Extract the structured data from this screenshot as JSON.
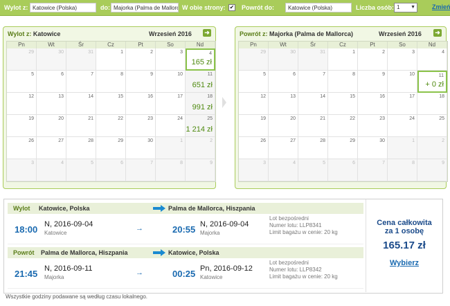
{
  "search": {
    "from_label": "Wylot z:",
    "from_value": "Katowice (Polska)",
    "to_label": "do:",
    "to_value": "Majorka (Palma de Mallorca",
    "both_ways_label": "W obie strony:",
    "both_ways_check": "✔",
    "return_label": "Powrót do:",
    "return_value": "Katowice (Polska)",
    "persons_label": "Liczba osób:",
    "persons_value": "1",
    "change_label": "Zmień"
  },
  "calendars": [
    {
      "title_prefix": "Wylot z:",
      "title_city": "Katowice",
      "month": "Wrzesień 2016",
      "next_icon": "➜",
      "days": [
        "Pn",
        "Wt",
        "Śr",
        "Cz",
        "Pt",
        "So",
        "Nd"
      ],
      "cells": [
        {
          "d": "29",
          "other": true
        },
        {
          "d": "30",
          "other": true
        },
        {
          "d": "31",
          "other": true
        },
        {
          "d": "1"
        },
        {
          "d": "2"
        },
        {
          "d": "3"
        },
        {
          "d": "4",
          "price": "165 zł",
          "selected": true
        },
        {
          "d": "5"
        },
        {
          "d": "6"
        },
        {
          "d": "7"
        },
        {
          "d": "8"
        },
        {
          "d": "9"
        },
        {
          "d": "10"
        },
        {
          "d": "11",
          "price": "651 zł"
        },
        {
          "d": "12"
        },
        {
          "d": "13"
        },
        {
          "d": "14"
        },
        {
          "d": "15"
        },
        {
          "d": "16"
        },
        {
          "d": "17"
        },
        {
          "d": "18",
          "price": "991 zł"
        },
        {
          "d": "19"
        },
        {
          "d": "20"
        },
        {
          "d": "21"
        },
        {
          "d": "22"
        },
        {
          "d": "23"
        },
        {
          "d": "24"
        },
        {
          "d": "25",
          "price": "1 214 zł"
        },
        {
          "d": "26"
        },
        {
          "d": "27"
        },
        {
          "d": "28"
        },
        {
          "d": "29"
        },
        {
          "d": "30"
        },
        {
          "d": "1",
          "other": true
        },
        {
          "d": "2",
          "other": true
        },
        {
          "d": "3",
          "other": true
        },
        {
          "d": "4",
          "other": true
        },
        {
          "d": "5",
          "other": true
        },
        {
          "d": "6",
          "other": true
        },
        {
          "d": "7",
          "other": true
        },
        {
          "d": "8",
          "other": true
        },
        {
          "d": "9",
          "other": true
        }
      ]
    },
    {
      "title_prefix": "Powrót z:",
      "title_city": "Majorka (Palma de Mallorca)",
      "month": "Wrzesień 2016",
      "next_icon": "➜",
      "days": [
        "Pn",
        "Wt",
        "Śr",
        "Cz",
        "Pt",
        "So",
        "Nd"
      ],
      "cells": [
        {
          "d": "29",
          "other": true
        },
        {
          "d": "30",
          "other": true
        },
        {
          "d": "31",
          "other": true
        },
        {
          "d": "1"
        },
        {
          "d": "2"
        },
        {
          "d": "3"
        },
        {
          "d": "4"
        },
        {
          "d": "5"
        },
        {
          "d": "6"
        },
        {
          "d": "7"
        },
        {
          "d": "8"
        },
        {
          "d": "9"
        },
        {
          "d": "10"
        },
        {
          "d": "11",
          "price": "+ 0 zł",
          "selected": true
        },
        {
          "d": "12"
        },
        {
          "d": "13"
        },
        {
          "d": "14"
        },
        {
          "d": "15"
        },
        {
          "d": "16"
        },
        {
          "d": "17"
        },
        {
          "d": "18"
        },
        {
          "d": "19"
        },
        {
          "d": "20"
        },
        {
          "d": "21"
        },
        {
          "d": "22"
        },
        {
          "d": "23"
        },
        {
          "d": "24"
        },
        {
          "d": "25"
        },
        {
          "d": "26"
        },
        {
          "d": "27"
        },
        {
          "d": "28"
        },
        {
          "d": "29"
        },
        {
          "d": "30"
        },
        {
          "d": "1",
          "other": true
        },
        {
          "d": "2",
          "other": true
        },
        {
          "d": "3",
          "other": true
        },
        {
          "d": "4",
          "other": true
        },
        {
          "d": "5",
          "other": true
        },
        {
          "d": "6",
          "other": true
        },
        {
          "d": "7",
          "other": true
        },
        {
          "d": "8",
          "other": true
        },
        {
          "d": "9",
          "other": true
        }
      ]
    }
  ],
  "summary": {
    "outbound": {
      "label": "Wylot",
      "from": "Katowice, Polska",
      "to": "Palma de Mallorca, Hiszpania",
      "dep_time": "18:00",
      "dep_date": "N, 2016-09-04",
      "dep_city": "Katowice",
      "arr_time": "20:55",
      "arr_date": "N, 2016-09-04",
      "arr_city": "Majorka",
      "info1": "Lot bezpośredni",
      "info2": "Numer lotu: LLP8341",
      "info3": "Limit bagażu w cenie: 20 kg"
    },
    "inbound": {
      "label": "Powrót",
      "from": "Palma de Mallorca, Hiszpania",
      "to": "Katowice, Polska",
      "dep_time": "21:45",
      "dep_date": "N, 2016-09-11",
      "dep_city": "Majorka",
      "arr_time": "00:25",
      "arr_date": "Pn, 2016-09-12",
      "arr_city": "Katowice",
      "info1": "Lot bezpośredni",
      "info2": "Numer lotu: LLP8342",
      "info3": "Limit bagażu w cenie: 20 kg"
    },
    "arrow_icon": "→",
    "price_label_line1": "Cena całkowita",
    "price_label_line2": "za 1 osobę",
    "price_value": "165.17 zł",
    "choose_label": "Wybierz"
  },
  "footnote": "Wszystkie godziny podawane są według czasu lokalnego.",
  "colors": {
    "accent_green": "#a9cc5a",
    "price_green": "#4f8a10",
    "link_blue": "#1a6ab0"
  }
}
